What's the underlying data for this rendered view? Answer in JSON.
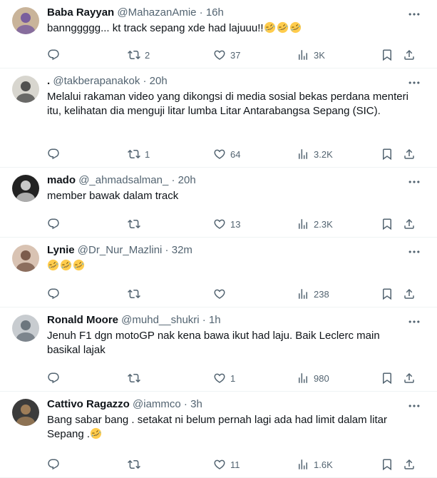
{
  "tweets": [
    {
      "name": "Baba Rayyan",
      "handle": "@MahazanAmie",
      "time": "16h",
      "text": "bannggggg... kt track sepang xde had lajuuu!!",
      "emoji_count": 3,
      "emoji": "rolling-on-floor-laughing",
      "replies": "",
      "retweets": "2",
      "likes": "37",
      "views": "3K",
      "avatar_colors": [
        "#c9b49a",
        "#6b4f9e"
      ]
    },
    {
      "name": ".",
      "handle": "@takberapanakok",
      "time": "20h",
      "text": "Melalui rakaman video yang dikongsi di media sosial bekas perdana menteri itu, kelihatan dia menguji litar lumba Litar Antarabangsa Sepang (SIC).",
      "emoji_count": 0,
      "replies": "",
      "retweets": "1",
      "likes": "64",
      "views": "3.2K",
      "avatar_colors": [
        "#d8d6cf",
        "#3a3a3a"
      ]
    },
    {
      "name": "mado",
      "handle": "@_ahmadsalman_",
      "time": "20h",
      "text": "member bawak dalam track",
      "emoji_count": 0,
      "replies": "",
      "retweets": "",
      "likes": "13",
      "views": "2.3K",
      "avatar_colors": [
        "#222222",
        "#e6e6e6"
      ]
    },
    {
      "name": "Lynie",
      "handle": "@Dr_Nur_Mazlini",
      "time": "32m",
      "text": "",
      "emoji_count": 3,
      "emoji": "rolling-on-floor-laughing",
      "replies": "",
      "retweets": "",
      "likes": "",
      "views": "238",
      "avatar_colors": [
        "#d9c3b3",
        "#6b4a3a"
      ]
    },
    {
      "name": "Ronald Moore",
      "handle": "@muhd__shukri",
      "time": "1h",
      "text": "Jenuh F1 dgn motoGP nak kena bawa ikut had laju. Baik Leclerc main basikal lajak",
      "emoji_count": 0,
      "replies": "",
      "retweets": "",
      "likes": "1",
      "views": "980",
      "avatar_colors": [
        "#c8ccd0",
        "#5c6670"
      ]
    },
    {
      "name": "Cattivo Ragazzo",
      "handle": "@iammco",
      "time": "3h",
      "text": "Bang sabar bang . setakat ni belum pernah lagi ada had limit dalam litar Sepang .",
      "emoji_count": 1,
      "emoji": "rolling-on-floor-laughing",
      "replies": "",
      "retweets": "",
      "likes": "11",
      "views": "1.6K",
      "avatar_colors": [
        "#3b3b3b",
        "#b08a5e"
      ]
    }
  ],
  "icons": {
    "reply": "reply-icon",
    "retweet": "retweet-icon",
    "like": "heart-icon",
    "views": "views-icon",
    "bookmark": "bookmark-icon",
    "share": "share-icon",
    "more": "more-icon"
  },
  "colors": {
    "text": "#0f1419",
    "secondary": "#536471",
    "divider": "#eff3f4"
  },
  "separator": "·"
}
